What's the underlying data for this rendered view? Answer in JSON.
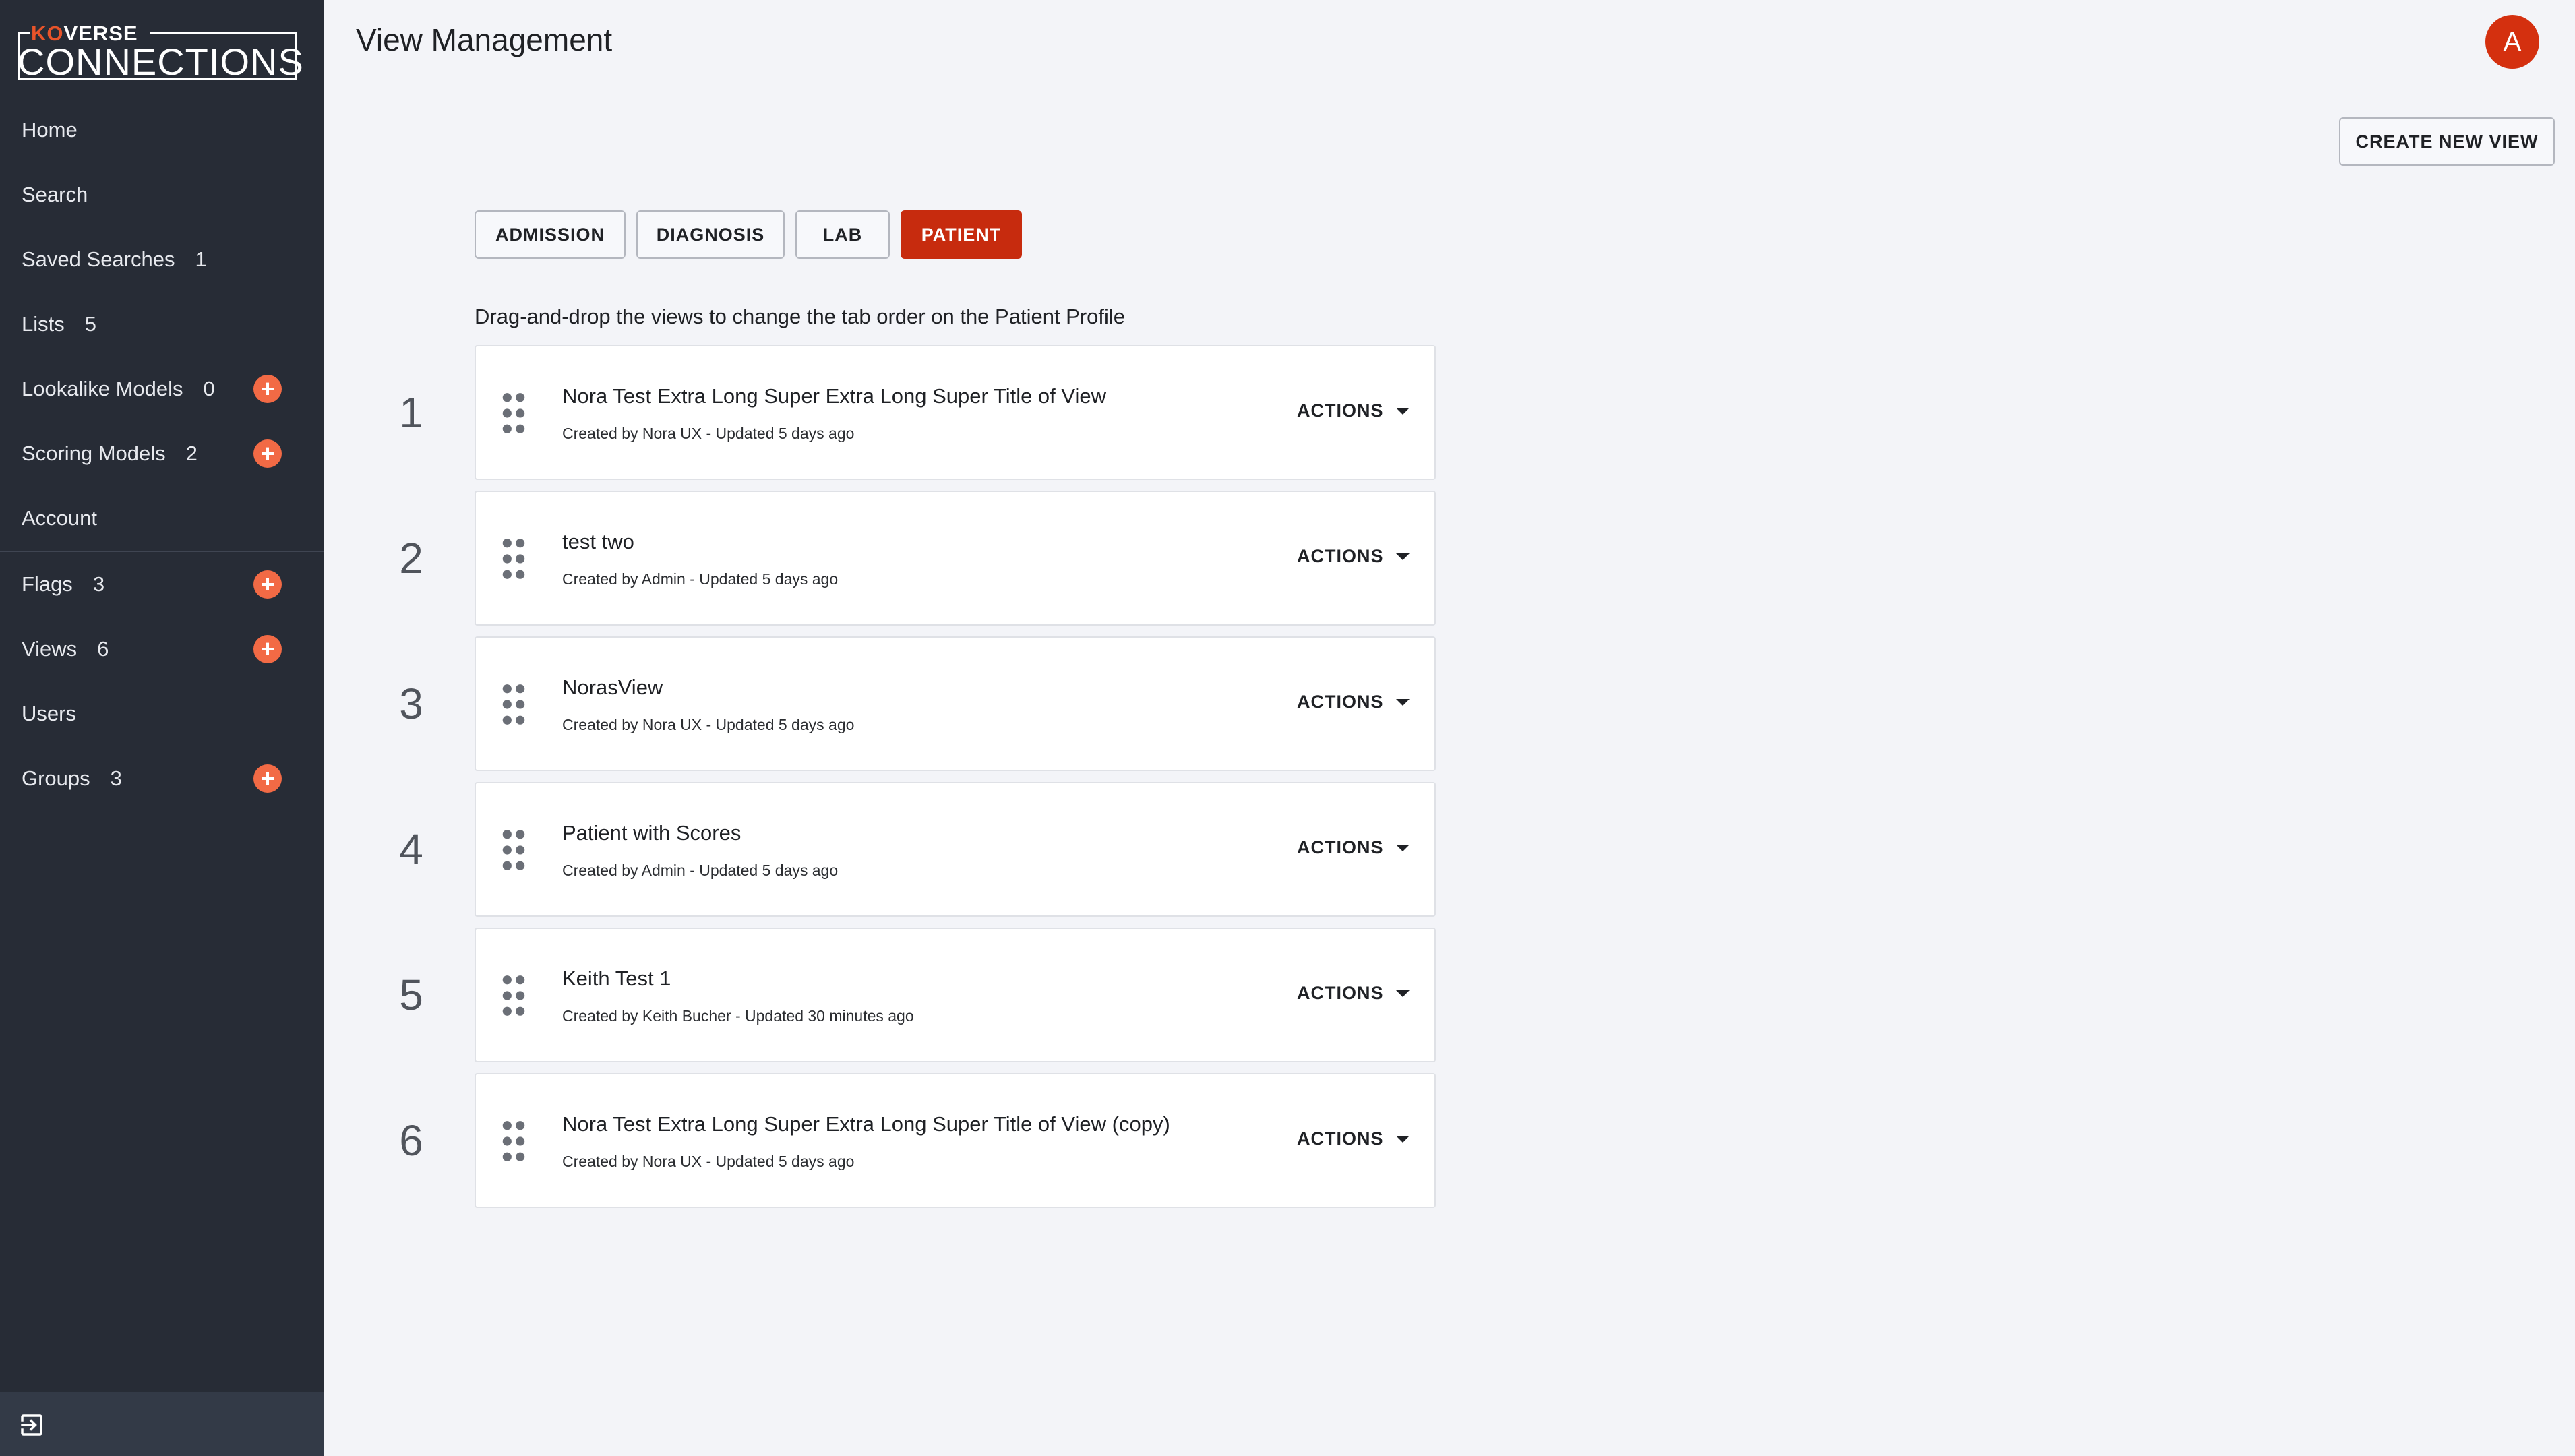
{
  "brand": {
    "top_ko": "KO",
    "top_rest": "VERSE",
    "bottom": "CONNECTIONS"
  },
  "sidebar": {
    "items": [
      {
        "label": "Home",
        "count": "",
        "add": false
      },
      {
        "label": "Search",
        "count": "",
        "add": false
      },
      {
        "label": "Saved Searches",
        "count": "1",
        "add": false
      },
      {
        "label": "Lists",
        "count": "5",
        "add": false
      },
      {
        "label": "Lookalike Models",
        "count": "0",
        "add": true
      },
      {
        "label": "Scoring Models",
        "count": "2",
        "add": true
      },
      {
        "label": "Account",
        "count": "",
        "add": false
      },
      {
        "label": "Flags",
        "count": "3",
        "add": true
      },
      {
        "label": "Views",
        "count": "6",
        "add": true
      },
      {
        "label": "Users",
        "count": "",
        "add": false
      },
      {
        "label": "Groups",
        "count": "3",
        "add": true
      }
    ],
    "add_symbol": "+",
    "logout_icon": "logout-icon"
  },
  "header": {
    "title": "View Management",
    "avatar_initial": "A"
  },
  "create_button": "CREATE NEW VIEW",
  "tabs": [
    {
      "label": "ADMISSION",
      "active": false
    },
    {
      "label": "DIAGNOSIS",
      "active": false
    },
    {
      "label": "LAB",
      "active": false
    },
    {
      "label": "PATIENT",
      "active": true
    }
  ],
  "hint": "Drag-and-drop the views to change the tab order on the Patient Profile",
  "views": [
    {
      "number": "1",
      "title": "Nora Test Extra Long Super Extra Long Super Title of View",
      "meta": "Created by Nora UX - Updated 5 days ago",
      "actions": "ACTIONS"
    },
    {
      "number": "2",
      "title": "test two",
      "meta": "Created by Admin - Updated 5 days ago",
      "actions": "ACTIONS"
    },
    {
      "number": "3",
      "title": "NorasView",
      "meta": "Created by Nora UX - Updated 5 days ago",
      "actions": "ACTIONS"
    },
    {
      "number": "4",
      "title": "Patient with Scores",
      "meta": "Created by Admin - Updated 5 days ago",
      "actions": "ACTIONS"
    },
    {
      "number": "5",
      "title": "Keith Test 1",
      "meta": "Created by Keith Bucher - Updated 30 minutes ago",
      "actions": "ACTIONS"
    },
    {
      "number": "6",
      "title": "Nora Test Extra Long Super Extra Long Super Title of View (copy)",
      "meta": "Created by Nora UX - Updated 5 days ago",
      "actions": "ACTIONS"
    }
  ],
  "colors": {
    "sidebar_bg": "#272c36",
    "accent": "#c72b0e",
    "add_icon": "#f26a45",
    "page_bg": "#f3f4f8"
  }
}
